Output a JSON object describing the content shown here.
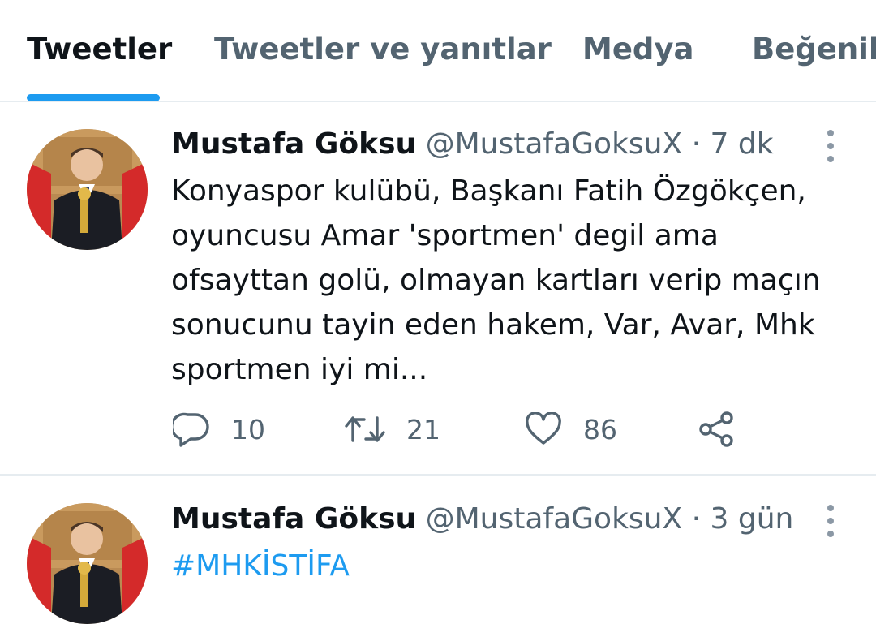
{
  "tabs": [
    {
      "label": "Tweetler",
      "active": true
    },
    {
      "label": "Tweetler ve yanıtlar",
      "active": false
    },
    {
      "label": "Medya",
      "active": false
    },
    {
      "label": "Beğeniler",
      "active": false
    }
  ],
  "colors": {
    "accent": "#1d9bf0",
    "text_primary": "#0f1419",
    "text_secondary": "#536471",
    "divider": "#e6ecf0"
  },
  "tweets": [
    {
      "name": "Mustafa Göksu",
      "handle": "@MustafaGoksuX",
      "separator": "·",
      "time": "7 dk",
      "text": "Konyaspor kulübü, Başkanı Fatih Özgökçen,\noyuncusu Amar 'sportmen' degil ama\nofsayttan golü, olmayan kartları verip maçın\nsonucunu tayin eden hakem, Var, Avar, Mhk\nsportmen iyi mi...",
      "replies": "10",
      "retweets": "21",
      "likes": "86",
      "icons": [
        "reply-icon",
        "retweet-icon",
        "like-icon",
        "share-icon",
        "more-icon"
      ]
    },
    {
      "name": "Mustafa Göksu",
      "handle": "@MustafaGoksuX",
      "separator": "·",
      "time": "3 gün",
      "text": "#MHKİSTİFA",
      "icons": [
        "more-icon"
      ]
    }
  ]
}
